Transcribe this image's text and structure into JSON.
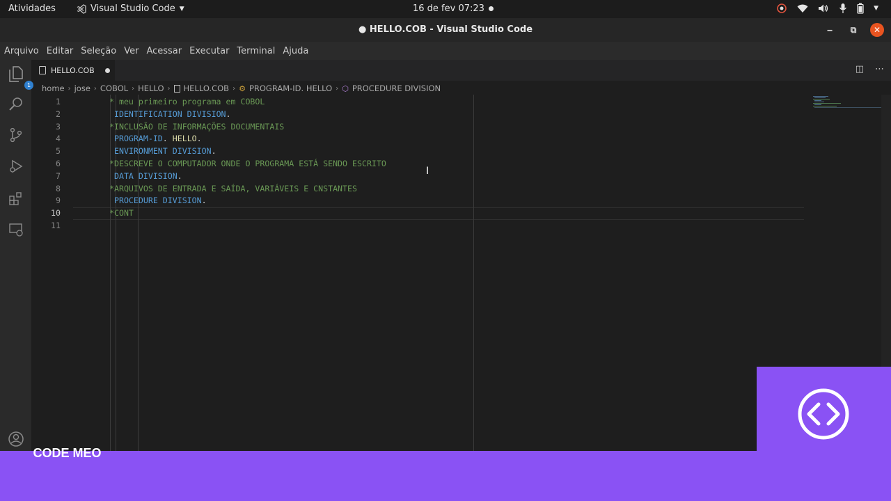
{
  "topbar": {
    "activities": "Atividades",
    "app_name": "Visual Studio Code",
    "clock": "16 de fev  07:23"
  },
  "window": {
    "title": "● HELLO.COB - Visual Studio Code"
  },
  "menu": [
    "Arquivo",
    "Editar",
    "Seleção",
    "Ver",
    "Acessar",
    "Executar",
    "Terminal",
    "Ajuda"
  ],
  "activity_bar": {
    "explorer_badge": "1",
    "icons": [
      "files-icon",
      "search-icon",
      "source-control-icon",
      "run-debug-icon",
      "extensions-icon",
      "remote-explorer-icon",
      "account-icon"
    ]
  },
  "tab": {
    "label": "HELLO.COB",
    "modified": true
  },
  "breadcrumb": [
    "home",
    "jose",
    "COBOL",
    "HELLO",
    "HELLO.COB",
    "PROGRAM-ID. HELLO",
    "PROCEDURE DIVISION"
  ],
  "editor": {
    "current_line": 10,
    "line_numbers": [
      "1",
      "2",
      "3",
      "4",
      "5",
      "6",
      "7",
      "8",
      "9",
      "10",
      "11"
    ],
    "lines": [
      [
        {
          "t": "* meu primeiro programa em COBOL",
          "c": "com"
        }
      ],
      [
        {
          "t": " ",
          "c": "punc"
        },
        {
          "t": "IDENTIFICATION DIVISION",
          "c": "key"
        },
        {
          "t": ".",
          "c": "punc"
        }
      ],
      [
        {
          "t": "*INCLUSÃO DE INFORMAÇÕES DOCUMENTAIS",
          "c": "com"
        }
      ],
      [
        {
          "t": " ",
          "c": "punc"
        },
        {
          "t": "PROGRAM-ID",
          "c": "key"
        },
        {
          "t": ". ",
          "c": "punc"
        },
        {
          "t": "HELLO",
          "c": "id"
        },
        {
          "t": ".",
          "c": "punc"
        }
      ],
      [
        {
          "t": " ",
          "c": "punc"
        },
        {
          "t": "ENVIRONMENT DIVISION",
          "c": "key"
        },
        {
          "t": ".",
          "c": "punc"
        }
      ],
      [
        {
          "t": "*DESCREVE O COMPUTADOR ONDE O PROGRAMA ESTÁ SENDO ESCRITO",
          "c": "com"
        }
      ],
      [
        {
          "t": " ",
          "c": "punc"
        },
        {
          "t": "DATA DIVISION",
          "c": "key"
        },
        {
          "t": ".",
          "c": "punc"
        }
      ],
      [
        {
          "t": "*ARQUIVOS DE ENTRADA E SAÍDA, VARIÁVEIS E CNSTANTES",
          "c": "com"
        }
      ],
      [
        {
          "t": " ",
          "c": "punc"
        },
        {
          "t": "PROCEDURE DIVISION",
          "c": "key"
        },
        {
          "t": ".",
          "c": "punc"
        }
      ],
      [
        {
          "t": "*CONT",
          "c": "com"
        }
      ],
      []
    ]
  },
  "watermark": {
    "brand": "CODE MEO",
    "accent": "#8a52f4"
  }
}
